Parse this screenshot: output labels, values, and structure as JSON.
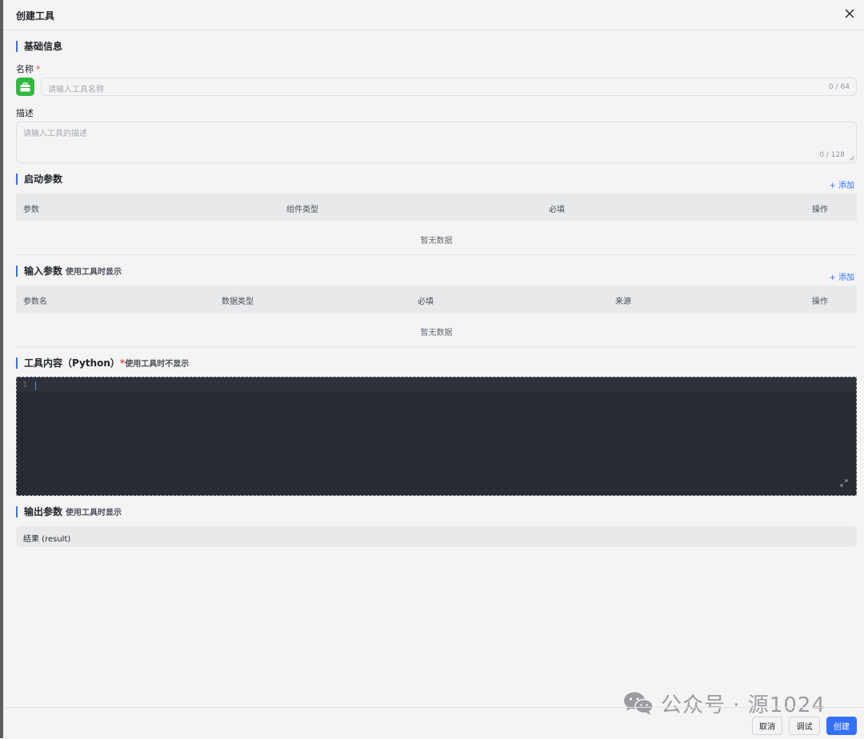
{
  "dialog": {
    "title": "创建工具"
  },
  "basic": {
    "section_title": "基础信息",
    "name_label": "名称",
    "name_required": "*",
    "name_placeholder": "请输入工具名称",
    "name_count": "0 / 64",
    "desc_label": "描述",
    "desc_placeholder": "请输入工具的描述",
    "desc_count": "0 / 128"
  },
  "startup_params": {
    "section_title": "启动参数",
    "add_label": "+ 添加",
    "columns": [
      "参数",
      "组件类型",
      "必填",
      "操作"
    ],
    "empty_text": "暂无数据"
  },
  "input_params": {
    "section_title": "输入参数",
    "section_sub": "使用工具时显示",
    "add_label": "+ 添加",
    "columns": [
      "参数名",
      "数据类型",
      "必填",
      "来源",
      "操作"
    ],
    "empty_text": "暂无数据"
  },
  "tool_content": {
    "section_title": "工具内容（Python）",
    "required_mark": "*",
    "section_sub": "使用工具时不显示",
    "line_number": "1"
  },
  "output_params": {
    "section_title": "输出参数",
    "section_sub": "使用工具时显示",
    "result_label": "结果 (result)"
  },
  "footer": {
    "cancel_label": "取消",
    "debug_label": "调试",
    "create_label": "创建"
  },
  "watermark": {
    "text": "公众号 · 源1024"
  },
  "colors": {
    "accent": "#3370ff",
    "required": "#f54a45",
    "tool_icon": "#2fb93f",
    "editor_bg": "#272b33"
  }
}
